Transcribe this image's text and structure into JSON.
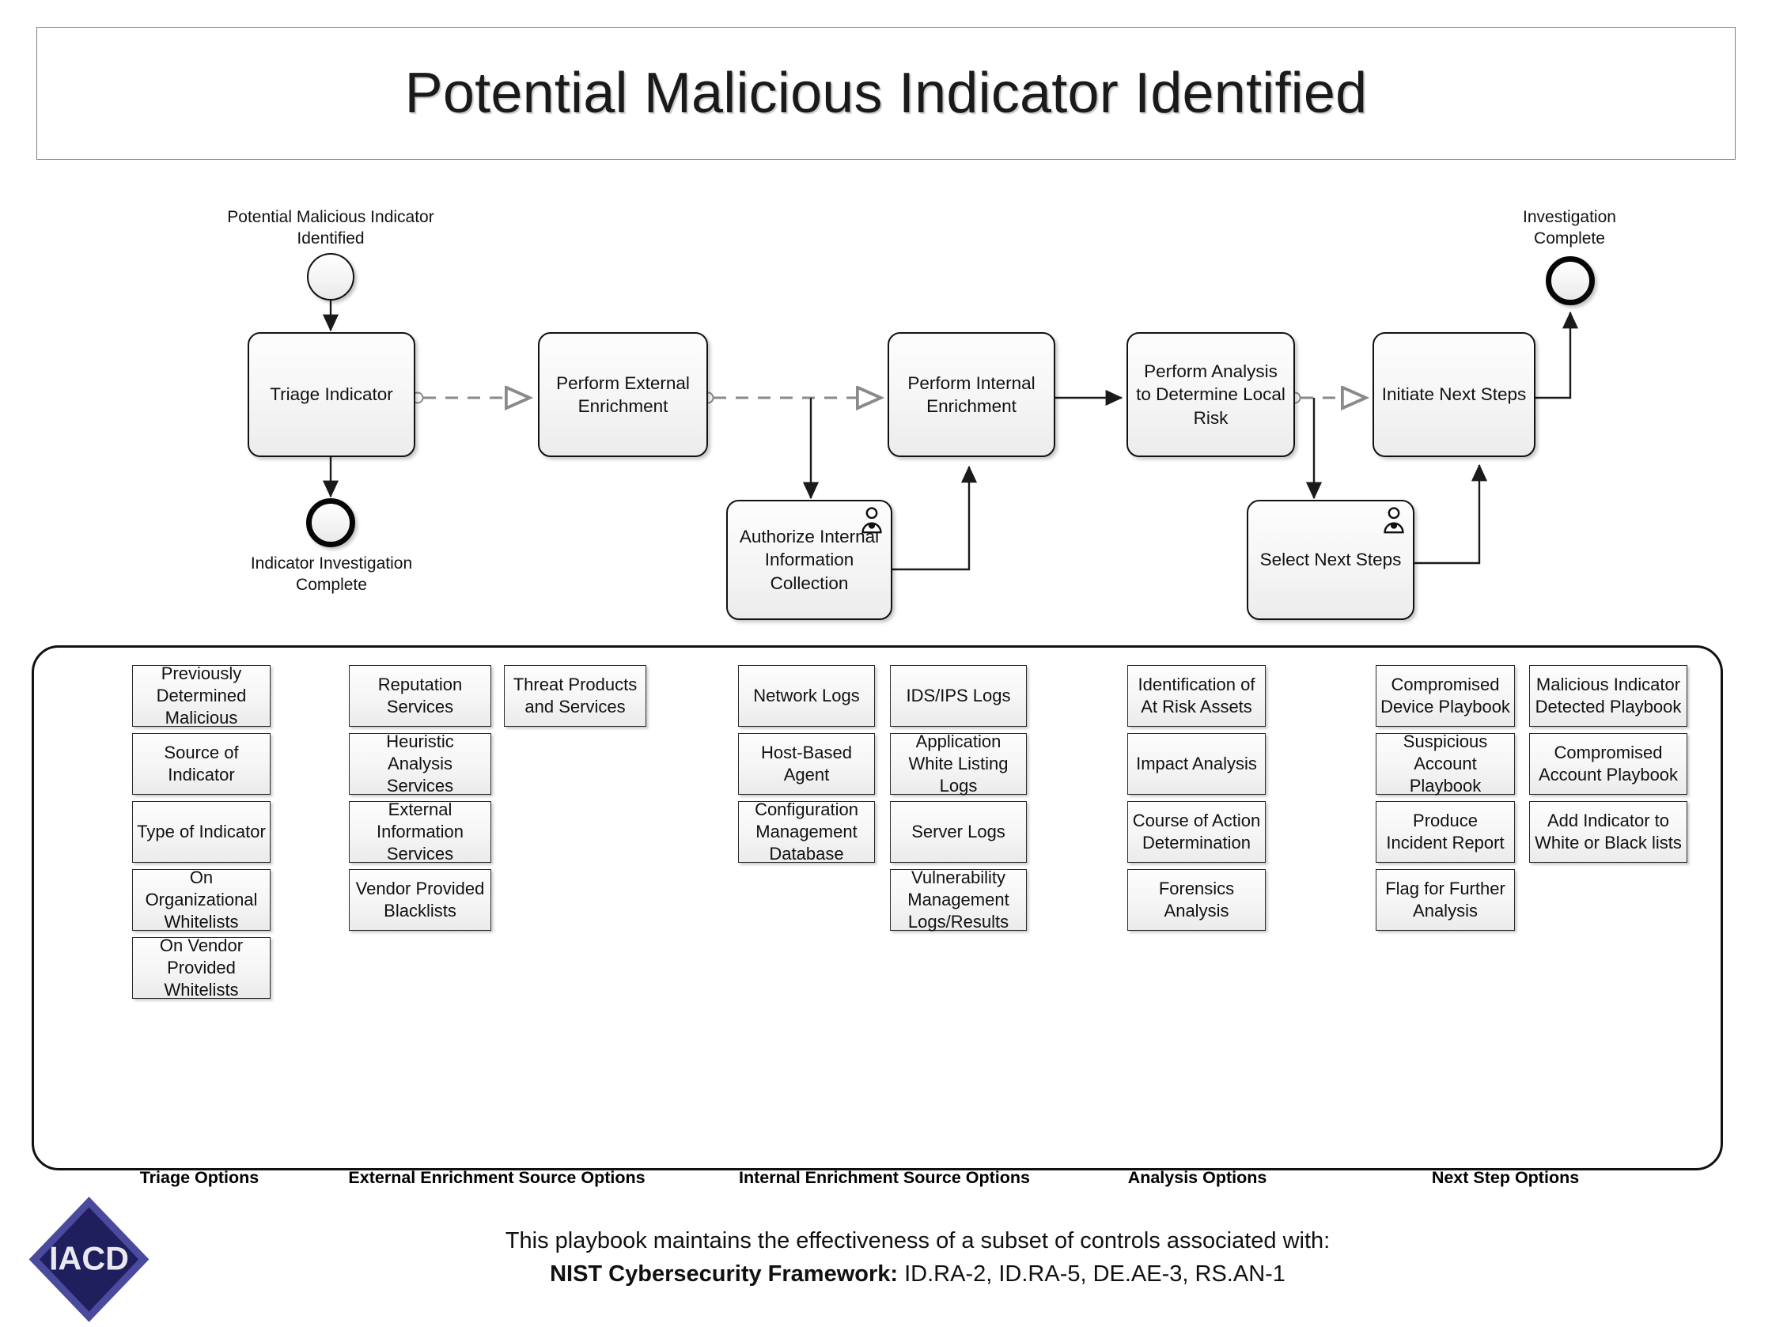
{
  "title": "Potential Malicious Indicator Identified",
  "flow": {
    "events": [
      {
        "id": "start",
        "type": "start-event",
        "label": "Potential Malicious Indicator Identified"
      },
      {
        "id": "end-indicator",
        "type": "end-event",
        "label": "Indicator Investigation Complete"
      },
      {
        "id": "end-investigation",
        "type": "end-event",
        "label": "Investigation Complete"
      }
    ],
    "tasks": [
      {
        "id": "triage",
        "label": "Triage Indicator",
        "user_task": false
      },
      {
        "id": "external-enrichment",
        "label": "Perform External Enrichment",
        "user_task": false
      },
      {
        "id": "internal-enrichment",
        "label": "Perform Internal Enrichment",
        "user_task": false
      },
      {
        "id": "analysis",
        "label": "Perform Analysis to Determine Local Risk",
        "user_task": false
      },
      {
        "id": "initiate-next-steps",
        "label": "Initiate Next Steps",
        "user_task": false
      },
      {
        "id": "authorize",
        "label": "Authorize Internal Information Collection",
        "user_task": true
      },
      {
        "id": "select-next-steps",
        "label": "Select Next Steps",
        "user_task": true
      }
    ]
  },
  "options": {
    "triage": {
      "caption": "Triage Options",
      "groups": [
        [
          "Previously Determined Malicious",
          "Source of Indicator",
          "Type of Indicator",
          "On Organizational Whitelists",
          "On Vendor Provided Whitelists"
        ]
      ]
    },
    "external_enrichment": {
      "caption": "External Enrichment Source Options",
      "groups": [
        [
          "Reputation Services",
          "Heuristic Analysis Services",
          "External Information Services",
          "Vendor Provided Blacklists"
        ],
        [
          "Threat Products and Services"
        ]
      ]
    },
    "internal_enrichment": {
      "caption": "Internal Enrichment Source Options",
      "groups": [
        [
          "Network Logs",
          "Host-Based Agent",
          "Configuration Management Database"
        ],
        [
          "IDS/IPS Logs",
          "Application White Listing Logs",
          "Server Logs",
          "Vulnerability Management Logs/Results"
        ]
      ]
    },
    "analysis": {
      "caption": "Analysis Options",
      "groups": [
        [
          "Identification of At Risk Assets",
          "Impact Analysis",
          "Course of Action Determination",
          "Forensics Analysis"
        ]
      ]
    },
    "next_step": {
      "caption": "Next Step Options",
      "groups": [
        [
          "Compromised Device Playbook",
          "Suspicious Account Playbook",
          "Produce Incident Report",
          "Flag for Further Analysis"
        ],
        [
          "Malicious Indicator Detected Playbook",
          "Compromised Account Playbook",
          "Add Indicator to White or Black lists"
        ]
      ]
    }
  },
  "footer": {
    "logo_text": "IACD",
    "line1": "This playbook maintains the effectiveness of a subset of controls associated with:",
    "line2_label": "NIST Cybersecurity Framework:",
    "line2_value": " ID.RA-2, ID.RA-5, DE.AE-3, RS.AN-1"
  },
  "colors": {
    "task_border": "#111111",
    "panel_border": "#111111",
    "message_flow": "#8a8a8a",
    "sequence_flow": "#1a1a1a",
    "logo_navy": "#1f1f5e",
    "logo_blue": "#4a4a9e"
  }
}
